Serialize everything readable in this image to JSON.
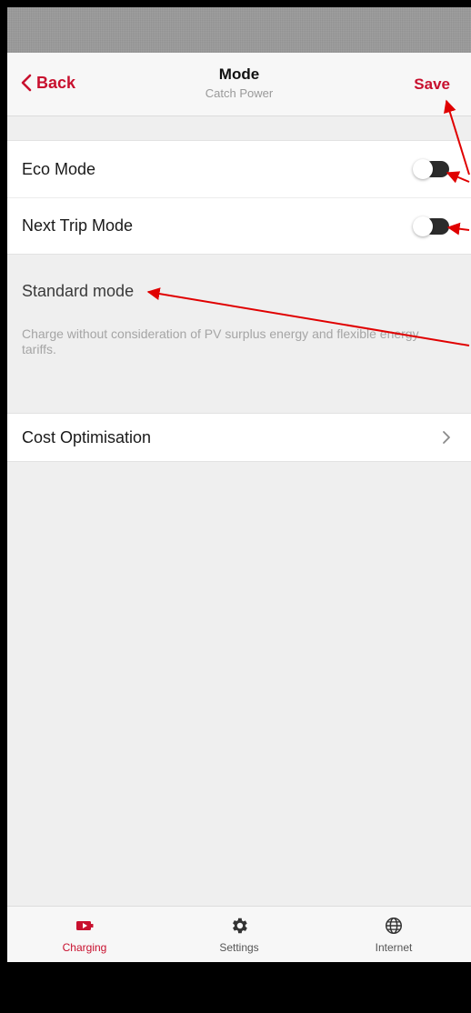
{
  "header": {
    "back_label": "Back",
    "title": "Mode",
    "subtitle": "Catch Power",
    "save_label": "Save"
  },
  "toggles": [
    {
      "label": "Eco Mode",
      "on": false
    },
    {
      "label": "Next Trip Mode",
      "on": false
    }
  ],
  "mode_info": {
    "heading": "Standard mode",
    "description": "Charge without consideration of PV surplus energy and flexible energy tariffs."
  },
  "cost_row": {
    "label": "Cost Optimisation"
  },
  "tab_bar": {
    "tabs": [
      {
        "label": "Charging",
        "icon": "battery-icon",
        "active": true
      },
      {
        "label": "Settings",
        "icon": "gear-icon",
        "active": false
      },
      {
        "label": "Internet",
        "icon": "globe-icon",
        "active": false
      }
    ]
  },
  "colors": {
    "accent": "#c8102e",
    "annotation": "#e00000",
    "background": "#efefef"
  }
}
